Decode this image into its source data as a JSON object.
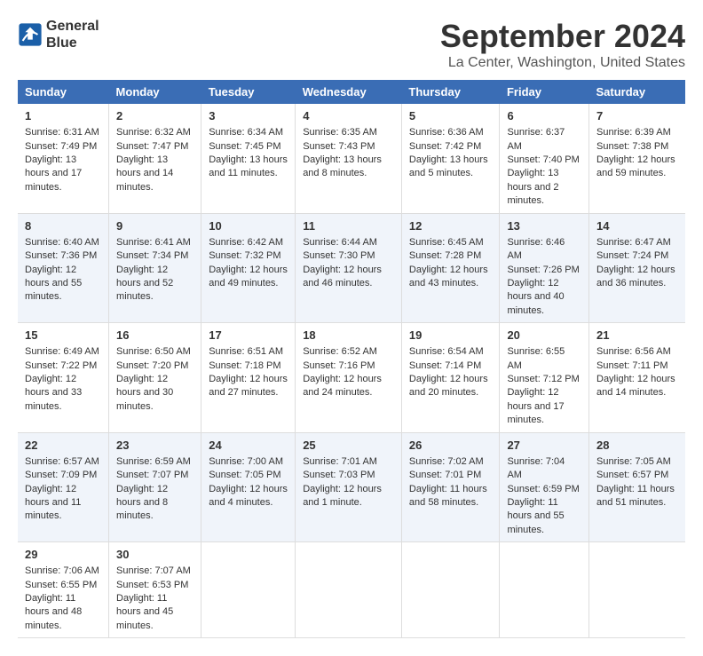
{
  "logo": {
    "line1": "General",
    "line2": "Blue"
  },
  "title": "September 2024",
  "location": "La Center, Washington, United States",
  "days_header": [
    "Sunday",
    "Monday",
    "Tuesday",
    "Wednesday",
    "Thursday",
    "Friday",
    "Saturday"
  ],
  "weeks": [
    [
      {
        "day": "1",
        "sunrise": "6:31 AM",
        "sunset": "7:49 PM",
        "daylight": "13 hours and 17 minutes."
      },
      {
        "day": "2",
        "sunrise": "6:32 AM",
        "sunset": "7:47 PM",
        "daylight": "13 hours and 14 minutes."
      },
      {
        "day": "3",
        "sunrise": "6:34 AM",
        "sunset": "7:45 PM",
        "daylight": "13 hours and 11 minutes."
      },
      {
        "day": "4",
        "sunrise": "6:35 AM",
        "sunset": "7:43 PM",
        "daylight": "13 hours and 8 minutes."
      },
      {
        "day": "5",
        "sunrise": "6:36 AM",
        "sunset": "7:42 PM",
        "daylight": "13 hours and 5 minutes."
      },
      {
        "day": "6",
        "sunrise": "6:37 AM",
        "sunset": "7:40 PM",
        "daylight": "13 hours and 2 minutes."
      },
      {
        "day": "7",
        "sunrise": "6:39 AM",
        "sunset": "7:38 PM",
        "daylight": "12 hours and 59 minutes."
      }
    ],
    [
      {
        "day": "8",
        "sunrise": "6:40 AM",
        "sunset": "7:36 PM",
        "daylight": "12 hours and 55 minutes."
      },
      {
        "day": "9",
        "sunrise": "6:41 AM",
        "sunset": "7:34 PM",
        "daylight": "12 hours and 52 minutes."
      },
      {
        "day": "10",
        "sunrise": "6:42 AM",
        "sunset": "7:32 PM",
        "daylight": "12 hours and 49 minutes."
      },
      {
        "day": "11",
        "sunrise": "6:44 AM",
        "sunset": "7:30 PM",
        "daylight": "12 hours and 46 minutes."
      },
      {
        "day": "12",
        "sunrise": "6:45 AM",
        "sunset": "7:28 PM",
        "daylight": "12 hours and 43 minutes."
      },
      {
        "day": "13",
        "sunrise": "6:46 AM",
        "sunset": "7:26 PM",
        "daylight": "12 hours and 40 minutes."
      },
      {
        "day": "14",
        "sunrise": "6:47 AM",
        "sunset": "7:24 PM",
        "daylight": "12 hours and 36 minutes."
      }
    ],
    [
      {
        "day": "15",
        "sunrise": "6:49 AM",
        "sunset": "7:22 PM",
        "daylight": "12 hours and 33 minutes."
      },
      {
        "day": "16",
        "sunrise": "6:50 AM",
        "sunset": "7:20 PM",
        "daylight": "12 hours and 30 minutes."
      },
      {
        "day": "17",
        "sunrise": "6:51 AM",
        "sunset": "7:18 PM",
        "daylight": "12 hours and 27 minutes."
      },
      {
        "day": "18",
        "sunrise": "6:52 AM",
        "sunset": "7:16 PM",
        "daylight": "12 hours and 24 minutes."
      },
      {
        "day": "19",
        "sunrise": "6:54 AM",
        "sunset": "7:14 PM",
        "daylight": "12 hours and 20 minutes."
      },
      {
        "day": "20",
        "sunrise": "6:55 AM",
        "sunset": "7:12 PM",
        "daylight": "12 hours and 17 minutes."
      },
      {
        "day": "21",
        "sunrise": "6:56 AM",
        "sunset": "7:11 PM",
        "daylight": "12 hours and 14 minutes."
      }
    ],
    [
      {
        "day": "22",
        "sunrise": "6:57 AM",
        "sunset": "7:09 PM",
        "daylight": "12 hours and 11 minutes."
      },
      {
        "day": "23",
        "sunrise": "6:59 AM",
        "sunset": "7:07 PM",
        "daylight": "12 hours and 8 minutes."
      },
      {
        "day": "24",
        "sunrise": "7:00 AM",
        "sunset": "7:05 PM",
        "daylight": "12 hours and 4 minutes."
      },
      {
        "day": "25",
        "sunrise": "7:01 AM",
        "sunset": "7:03 PM",
        "daylight": "12 hours and 1 minute."
      },
      {
        "day": "26",
        "sunrise": "7:02 AM",
        "sunset": "7:01 PM",
        "daylight": "11 hours and 58 minutes."
      },
      {
        "day": "27",
        "sunrise": "7:04 AM",
        "sunset": "6:59 PM",
        "daylight": "11 hours and 55 minutes."
      },
      {
        "day": "28",
        "sunrise": "7:05 AM",
        "sunset": "6:57 PM",
        "daylight": "11 hours and 51 minutes."
      }
    ],
    [
      {
        "day": "29",
        "sunrise": "7:06 AM",
        "sunset": "6:55 PM",
        "daylight": "11 hours and 48 minutes."
      },
      {
        "day": "30",
        "sunrise": "7:07 AM",
        "sunset": "6:53 PM",
        "daylight": "11 hours and 45 minutes."
      },
      null,
      null,
      null,
      null,
      null
    ]
  ]
}
